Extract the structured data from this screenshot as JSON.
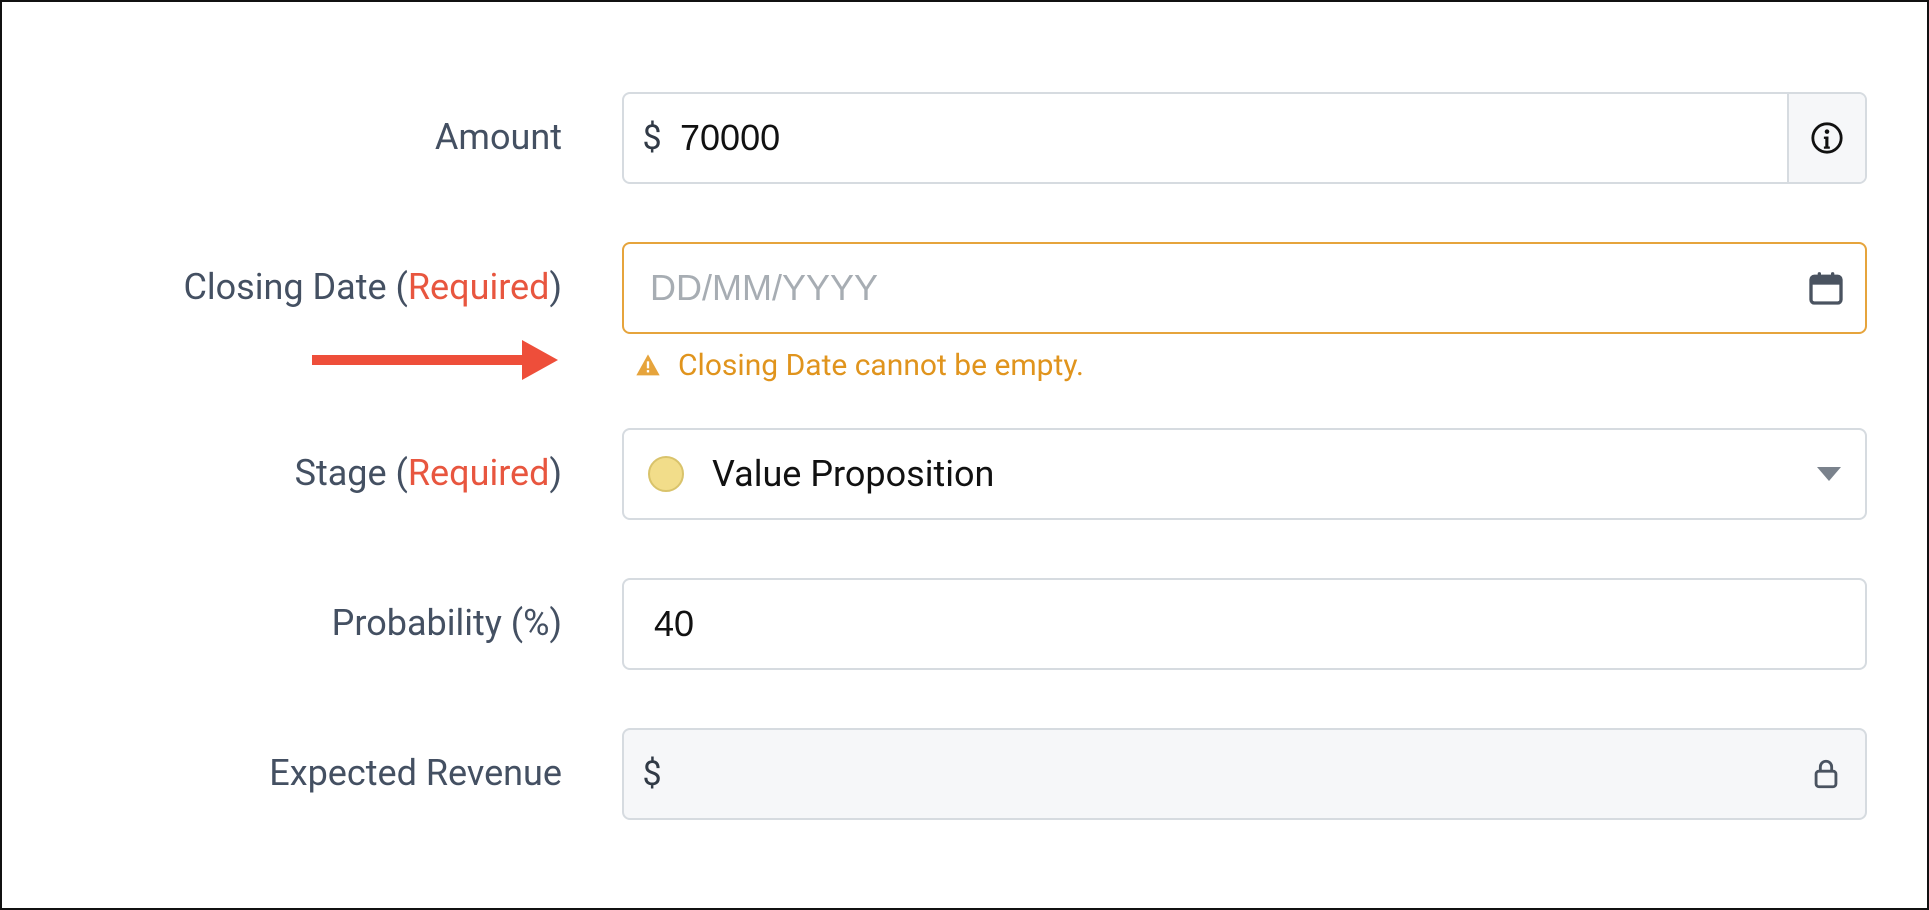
{
  "fields": {
    "amount": {
      "label": "Amount",
      "currency_prefix": "$",
      "value": "70000"
    },
    "closing_date": {
      "label_pre": "Closing Date (",
      "label_req": "Required",
      "label_post": ")",
      "placeholder": "DD/MM/YYYY",
      "value": "",
      "error": "Closing Date cannot be empty."
    },
    "stage": {
      "label_pre": "Stage (",
      "label_req": "Required",
      "label_post": ")",
      "selected": "Value Proposition"
    },
    "probability": {
      "label": "Probability (%)",
      "value": "40"
    },
    "expected_revenue": {
      "label": "Expected Revenue",
      "currency_prefix": "$",
      "value": ""
    }
  },
  "colors": {
    "required": "#e8563f",
    "warning": "#e0941d",
    "error_border": "#e6a43c",
    "stage_dot": "#f2dd8a",
    "annotation_arrow": "#ee4e3a"
  }
}
